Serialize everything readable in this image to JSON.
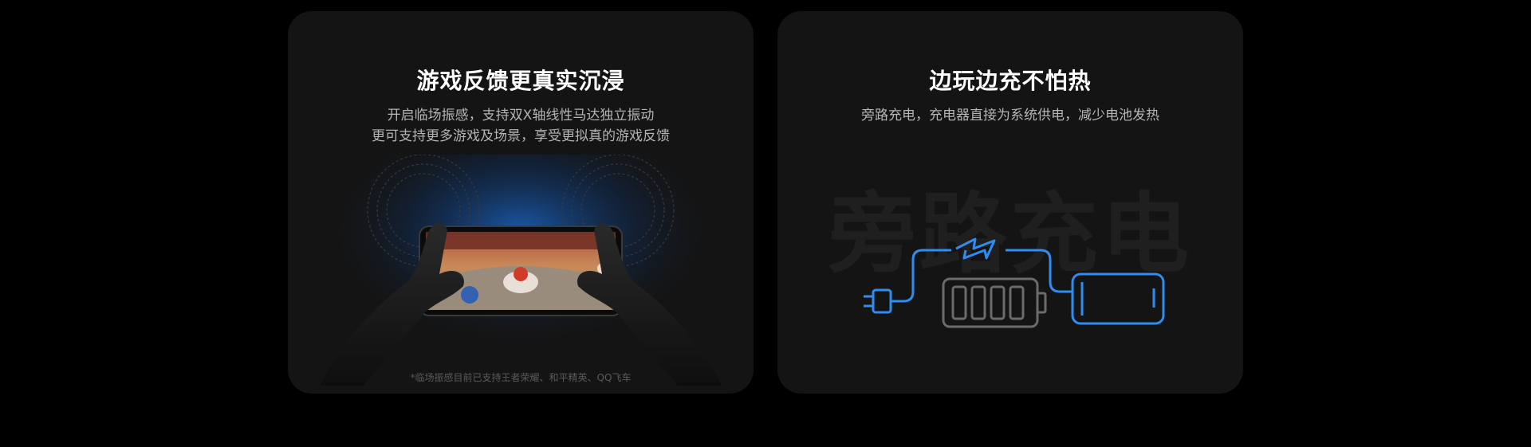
{
  "cards": [
    {
      "title": "游戏反馈更真实沉浸",
      "desc_line1": "开启临场振感，支持双X轴线性马达独立振动",
      "desc_line2": "更可支持更多游戏及场景，享受更拟真的游戏反馈",
      "footnote": "*临场振感目前已支持王者荣耀、和平精英、QQ飞车",
      "icons": [
        "vibration-wave-icon",
        "phone-game-icon",
        "hand-icon"
      ]
    },
    {
      "title": "边玩边充不怕热",
      "desc": "旁路充电，充电器直接为系统供电，减少电池发热",
      "watermark": "旁路充电",
      "icons": [
        "plug-icon",
        "lightning-icon",
        "battery-icon",
        "phone-outline-icon"
      ]
    }
  ],
  "colors": {
    "background": "#000000",
    "card": "#141414",
    "accent_blue": "#2f8cf0",
    "battery_gray": "#6b6b6b"
  }
}
